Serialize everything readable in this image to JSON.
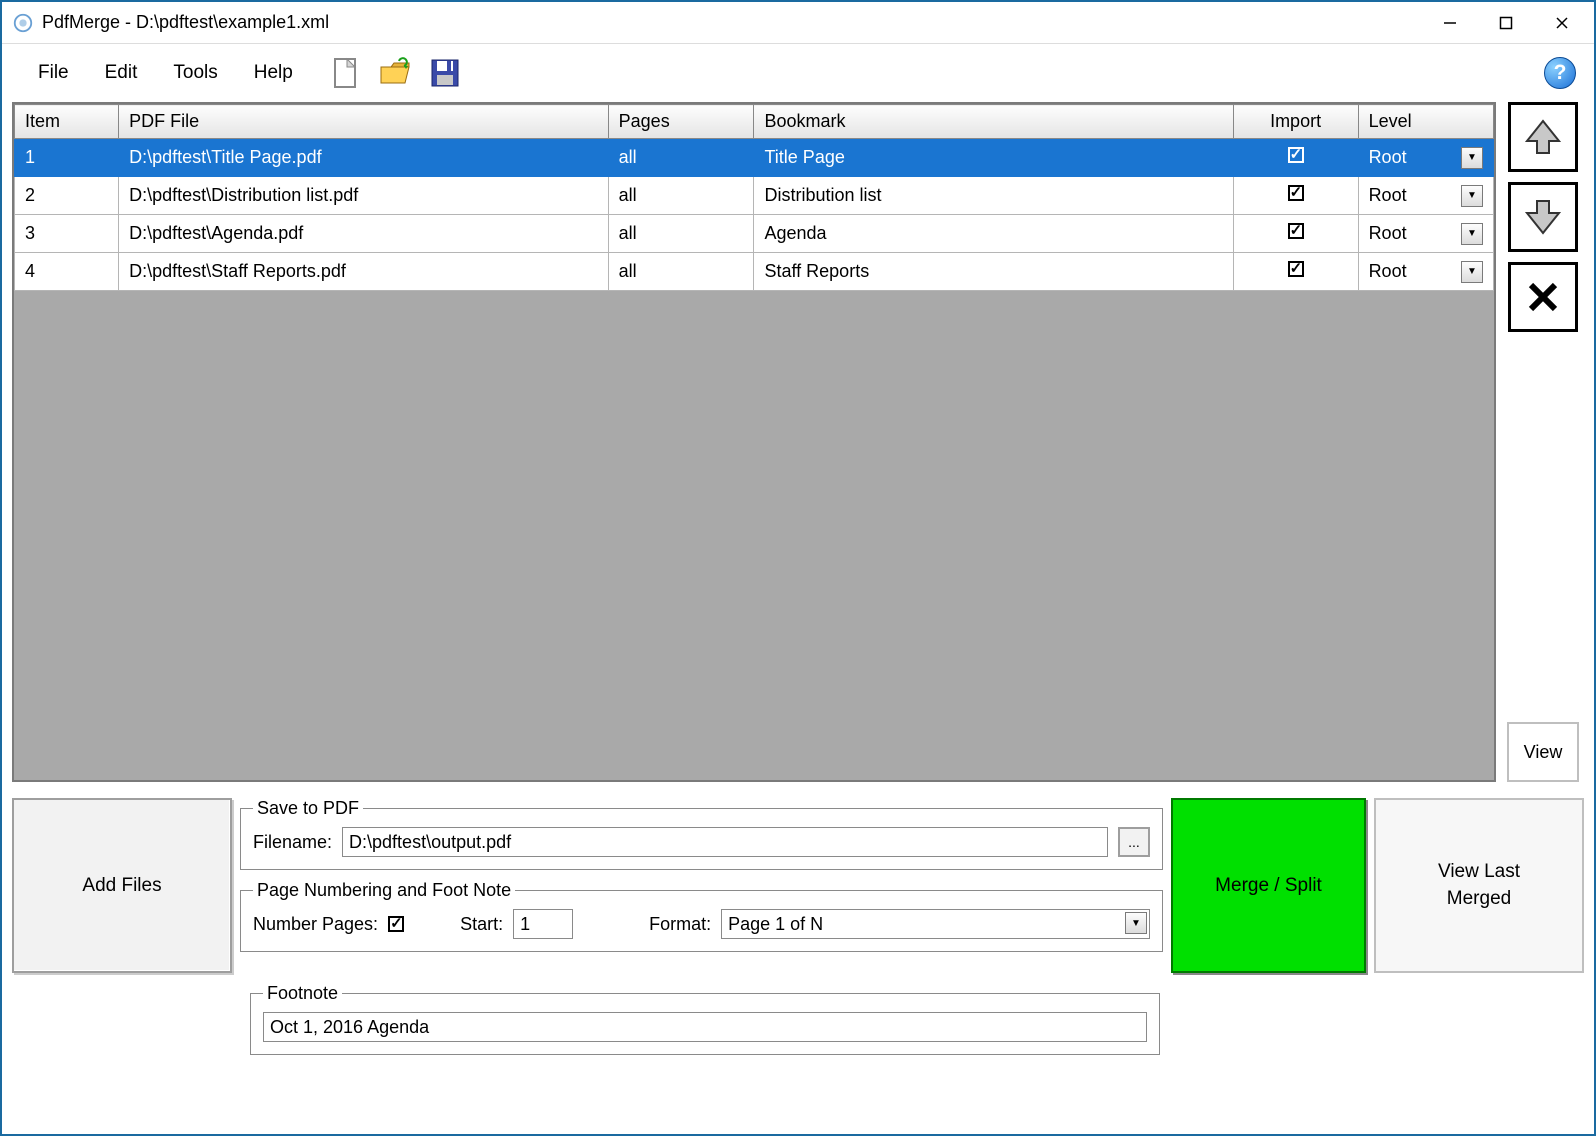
{
  "window": {
    "title": "PdfMerge - D:\\pdftest\\example1.xml"
  },
  "menu": {
    "file": "File",
    "edit": "Edit",
    "tools": "Tools",
    "help": "Help"
  },
  "table": {
    "headers": {
      "item": "Item",
      "pdf_file": "PDF File",
      "pages": "Pages",
      "bookmark": "Bookmark",
      "import": "Import",
      "level": "Level"
    },
    "rows": [
      {
        "item": "1",
        "file": "D:\\pdftest\\Title Page.pdf",
        "pages": "all",
        "bookmark": "Title Page",
        "import": true,
        "level": "Root",
        "selected": true
      },
      {
        "item": "2",
        "file": "D:\\pdftest\\Distribution list.pdf",
        "pages": "all",
        "bookmark": "Distribution list",
        "import": true,
        "level": "Root",
        "selected": false
      },
      {
        "item": "3",
        "file": "D:\\pdftest\\Agenda.pdf",
        "pages": "all",
        "bookmark": "Agenda",
        "import": true,
        "level": "Root",
        "selected": false
      },
      {
        "item": "4",
        "file": "D:\\pdftest\\Staff Reports.pdf",
        "pages": "all",
        "bookmark": "Staff Reports",
        "import": true,
        "level": "Root",
        "selected": false
      }
    ]
  },
  "side": {
    "view": "View"
  },
  "save": {
    "legend": "Save to PDF",
    "filename_label": "Filename:",
    "filename_value": "D:\\pdftest\\output.pdf",
    "browse": "..."
  },
  "numbering": {
    "legend": "Page Numbering and Foot Note",
    "number_pages_label": "Number Pages:",
    "number_pages_checked": true,
    "start_label": "Start:",
    "start_value": "1",
    "format_label": "Format:",
    "format_value": "Page 1 of N"
  },
  "footnote": {
    "legend": "Footnote",
    "value": "Oct 1, 2016 Agenda"
  },
  "buttons": {
    "add_files": "Add Files",
    "merge": "Merge / Split",
    "view_last": "View Last\nMerged"
  }
}
